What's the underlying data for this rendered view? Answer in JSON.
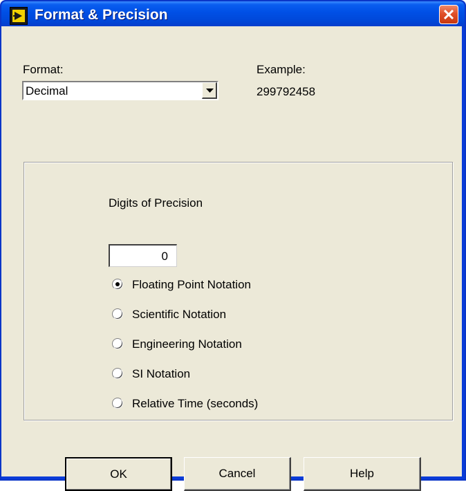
{
  "window": {
    "title": "Format & Precision",
    "icon": "labview-run-icon",
    "close_icon": "close-icon"
  },
  "format": {
    "label": "Format:",
    "selected": "Decimal",
    "dropdown_icon": "chevron-down-icon"
  },
  "example": {
    "label": "Example:",
    "value": "299792458"
  },
  "precision": {
    "label": "Digits of Precision",
    "value": "0"
  },
  "notation": {
    "options": [
      {
        "label": "Floating Point Notation",
        "selected": true
      },
      {
        "label": "Scientific Notation",
        "selected": false
      },
      {
        "label": "Engineering Notation",
        "selected": false
      },
      {
        "label": "SI Notation",
        "selected": false
      },
      {
        "label": "Relative Time (seconds)",
        "selected": false
      }
    ]
  },
  "buttons": {
    "ok": "OK",
    "cancel": "Cancel",
    "help": "Help"
  },
  "colors": {
    "titlebar": "#0050e6",
    "dialog_bg": "#ece9d8",
    "close_button": "#e0502a"
  }
}
